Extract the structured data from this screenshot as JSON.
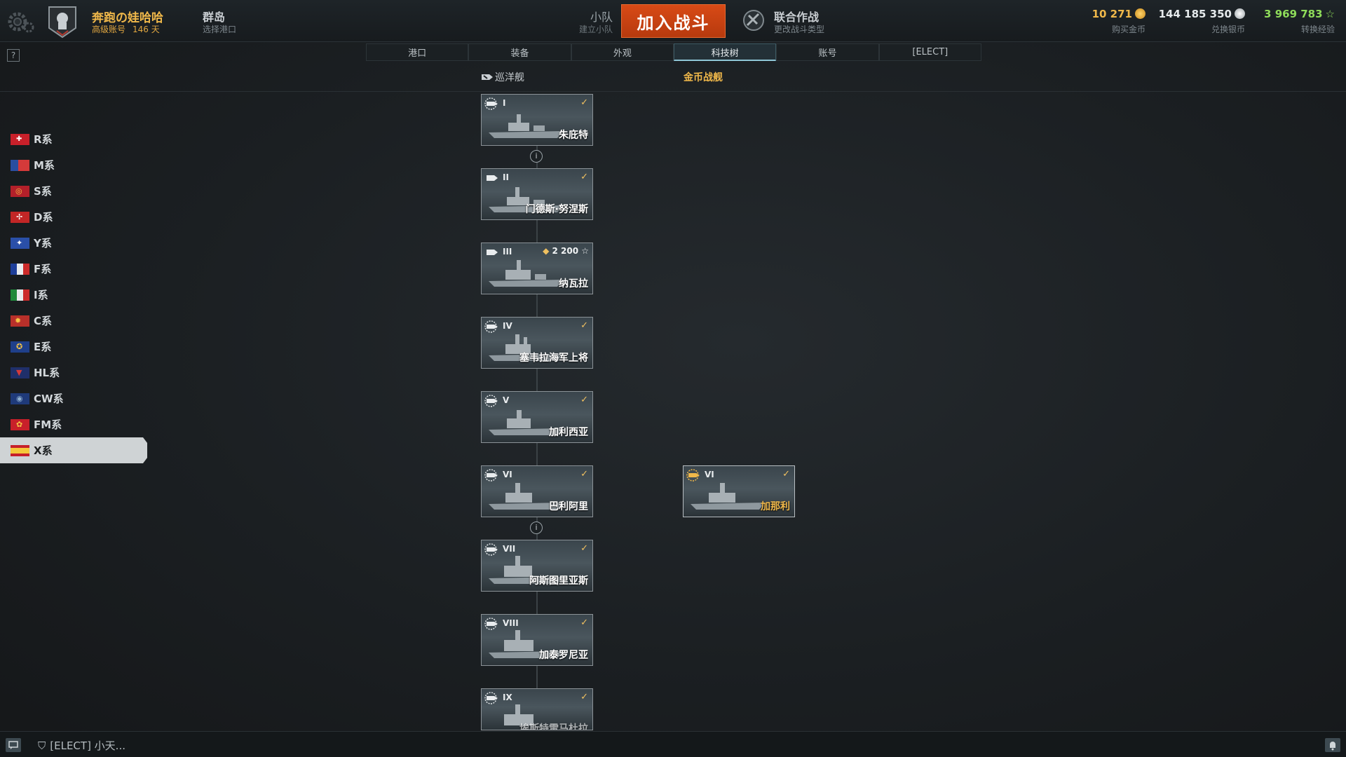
{
  "header": {
    "player_name": "奔跑の娃哈哈",
    "account_type": "高级账号",
    "premium_days": "146 天",
    "port_name": "群岛",
    "port_sub": "选择港口",
    "squad_title": "小队",
    "squad_sub": "建立小队",
    "battle_button": "加入战斗",
    "operation_title": "联合作战",
    "operation_sub": "更改战斗类型",
    "gold": "10 271",
    "gold_label": "购买金币",
    "credits": "144 185 350",
    "credits_label": "兑换银币",
    "free_xp": "3 969 783",
    "free_xp_label": "转换经验"
  },
  "help_label": "?",
  "tabs": [
    {
      "label": "港口"
    },
    {
      "label": "装备"
    },
    {
      "label": "外观"
    },
    {
      "label": "科技树"
    },
    {
      "label": "账号"
    },
    {
      "label": "[ELECT]"
    }
  ],
  "active_tab": "科技树",
  "columns": {
    "main": "巡洋舰",
    "premium": "金币战舰"
  },
  "nations": [
    {
      "label": "R系"
    },
    {
      "label": "M系"
    },
    {
      "label": "S系"
    },
    {
      "label": "D系"
    },
    {
      "label": "Y系"
    },
    {
      "label": "F系"
    },
    {
      "label": "I系"
    },
    {
      "label": "C系"
    },
    {
      "label": "E系"
    },
    {
      "label": "HL系"
    },
    {
      "label": "CW系"
    },
    {
      "label": "FM系"
    },
    {
      "label": "X系"
    }
  ],
  "active_nation": "X系",
  "ships": [
    {
      "tier": "I",
      "name": "朱庇特",
      "researched": "✓"
    },
    {
      "tier": "II",
      "name": "门德斯·努涅斯",
      "researched": "✓"
    },
    {
      "tier": "III",
      "name": "纳瓦拉",
      "xp_cost": "2 200 ☆"
    },
    {
      "tier": "IV",
      "name": "塞韦拉海军上将",
      "researched": "✓"
    },
    {
      "tier": "V",
      "name": "加利西亚",
      "researched": "✓"
    },
    {
      "tier": "VI",
      "name": "巴利阿里",
      "researched": "✓"
    },
    {
      "tier": "VII",
      "name": "阿斯图里亚斯",
      "researched": "✓"
    },
    {
      "tier": "VIII",
      "name": "加泰罗尼亚",
      "researched": "✓"
    },
    {
      "tier": "IX",
      "name": "埃斯特雷马杜拉",
      "researched": "✓"
    }
  ],
  "premium_ships": [
    {
      "tier": "VI",
      "name": "加那利",
      "researched": "✓"
    }
  ],
  "info_marker": "i",
  "footer": {
    "clan_chat": "[ELECT]  小天..."
  },
  "colors": {
    "accent_orange": "#c9420f",
    "gold_text": "#f0b84a",
    "free_xp": "#8fdc5a"
  }
}
